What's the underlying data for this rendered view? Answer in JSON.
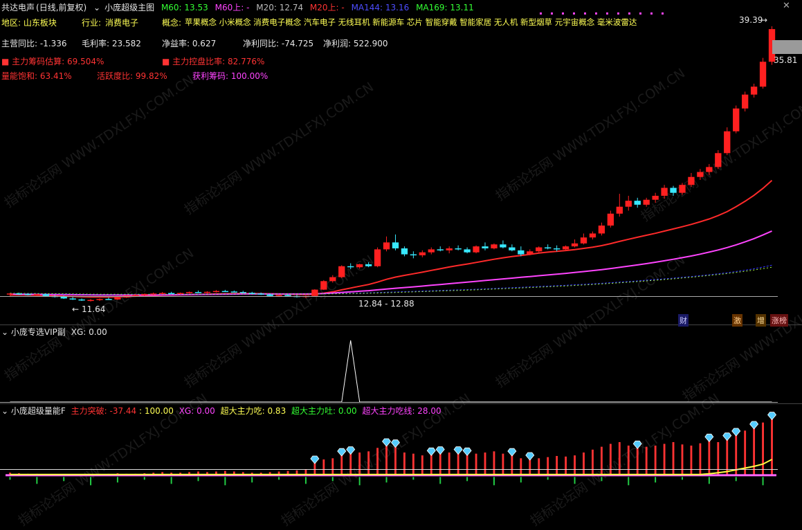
{
  "main_header": {
    "stock": "共达电声",
    "period": "(日线,前复权)",
    "indicator": "小庞超级主图",
    "m60": "M60: 13.53",
    "m60_up": "M60上: -",
    "m20": "M20: 12.74",
    "m20_up": "M20上: -",
    "ma144": "MA144: 13.16",
    "ma169": "MA169: 13.11"
  },
  "info": {
    "region": "地区: 山东板块",
    "industry_label": "行业:",
    "industry": "消费电子",
    "concept_label": "概念:",
    "concepts": "苹果概念 小米概念 消费电子概念 汽车电子 无线耳机 新能源车 芯片 智能穿戴 智能家居 无人机 新型烟草 元宇宙概念 毫米波雷达",
    "rev_growth": "主营同比: -1.336",
    "gross_margin": "毛利率: 23.582",
    "roe": "净益率: 0.627",
    "np_growth": "净利同比: -74.725",
    "net_profit": "净利润: 522.900"
  },
  "chips": {
    "main_chip_est": "主力筹码估算: 69.504%",
    "main_control": "主力控盘比率: 82.776%",
    "vol_sat": "量能饱和: 63.41%",
    "activity": "活跃度比: 99.82%",
    "profit_chip": "获利筹码: 100.00%"
  },
  "price_labels": {
    "high": "39.39",
    "current": "35.81",
    "low": "11.64",
    "range": "12.84 - 12.88"
  },
  "event_tags": [
    "财",
    "激",
    "增",
    "涨榜"
  ],
  "panel2": {
    "title": "小庞专选VIP副",
    "xg": "XG: 0.00"
  },
  "panel3": {
    "title": "小庞超级量能F",
    "main_break": "主力突破: -37.44",
    "level": ": 100.00",
    "xg": "XG: 0.00",
    "super_eat": "超大主力吃: 0.83",
    "super_spit": "超大主力吐: 0.00",
    "super_eat_line": "超大主力吃线: 28.00"
  },
  "watermark": "指标论坛网 WWW.TDXLFXJ.COM.CN",
  "colors": {
    "up": "#ff2020",
    "down": "#38e8ff",
    "m20": "#ff2a2a",
    "m60": "#ff44ff",
    "ma144": "#3333ff",
    "ma169": "#aaff44"
  },
  "chart_data": {
    "type": "candlestick",
    "x_label": "",
    "y_label": "",
    "ylim": [
      11.0,
      40.5
    ],
    "candles": [
      [
        12.35,
        12.5,
        12.2,
        12.45
      ],
      [
        12.45,
        12.55,
        12.3,
        12.4
      ],
      [
        12.4,
        12.48,
        12.25,
        12.3
      ],
      [
        12.3,
        12.42,
        12.2,
        12.38
      ],
      [
        12.38,
        12.45,
        12.15,
        12.2
      ],
      [
        12.2,
        12.3,
        12.05,
        12.15
      ],
      [
        12.15,
        12.25,
        11.9,
        11.95
      ],
      [
        11.95,
        12.1,
        11.8,
        11.85
      ],
      [
        11.85,
        11.95,
        11.7,
        11.75
      ],
      [
        11.75,
        11.9,
        11.64,
        11.8
      ],
      [
        11.8,
        11.95,
        11.7,
        11.9
      ],
      [
        11.9,
        12.05,
        11.8,
        11.85
      ],
      [
        11.85,
        12.1,
        11.8,
        12.05
      ],
      [
        12.05,
        12.3,
        12.0,
        12.25
      ],
      [
        12.25,
        12.4,
        12.15,
        12.3
      ],
      [
        12.3,
        12.45,
        12.2,
        12.4
      ],
      [
        12.4,
        12.55,
        12.3,
        12.45
      ],
      [
        12.45,
        12.6,
        12.35,
        12.5
      ],
      [
        12.5,
        12.62,
        12.4,
        12.42
      ],
      [
        12.42,
        12.55,
        12.35,
        12.5
      ],
      [
        12.5,
        12.65,
        12.45,
        12.6
      ],
      [
        12.6,
        12.75,
        12.5,
        12.55
      ],
      [
        12.55,
        12.68,
        12.45,
        12.62
      ],
      [
        12.62,
        12.8,
        12.55,
        12.7
      ],
      [
        12.7,
        12.82,
        12.6,
        12.65
      ],
      [
        12.65,
        12.75,
        12.55,
        12.6
      ],
      [
        12.6,
        12.72,
        12.48,
        12.52
      ],
      [
        12.52,
        12.62,
        12.4,
        12.45
      ],
      [
        12.45,
        12.55,
        12.3,
        12.35
      ],
      [
        12.35,
        12.45,
        12.15,
        12.2
      ],
      [
        12.2,
        12.35,
        12.1,
        12.3
      ],
      [
        12.3,
        12.4,
        12.15,
        12.2
      ],
      [
        12.2,
        12.3,
        12.05,
        12.1
      ],
      [
        12.1,
        12.25,
        12.0,
        12.2
      ],
      [
        12.2,
        12.88,
        12.15,
        12.84
      ],
      [
        12.84,
        13.8,
        12.8,
        13.7
      ],
      [
        13.7,
        14.3,
        13.55,
        14.1
      ],
      [
        14.1,
        15.3,
        14.0,
        15.2
      ],
      [
        15.2,
        15.5,
        14.9,
        15.1
      ],
      [
        15.1,
        15.45,
        14.95,
        15.4
      ],
      [
        15.4,
        15.6,
        15.1,
        15.2
      ],
      [
        15.2,
        17.1,
        15.1,
        16.9
      ],
      [
        16.9,
        18.2,
        16.7,
        17.6
      ],
      [
        17.6,
        18.4,
        16.8,
        17.0
      ],
      [
        17.0,
        17.2,
        16.2,
        16.4
      ],
      [
        16.4,
        16.7,
        16.0,
        16.3
      ],
      [
        16.3,
        16.8,
        16.1,
        16.6
      ],
      [
        16.6,
        17.1,
        16.4,
        16.9
      ],
      [
        16.9,
        17.2,
        16.7,
        16.8
      ],
      [
        16.8,
        17.2,
        16.5,
        17.0
      ],
      [
        17.0,
        17.3,
        16.8,
        16.9
      ],
      [
        16.9,
        17.1,
        16.5,
        16.6
      ],
      [
        16.6,
        17.3,
        16.5,
        17.2
      ],
      [
        17.2,
        17.6,
        16.8,
        17.0
      ],
      [
        17.0,
        17.5,
        16.9,
        17.4
      ],
      [
        17.4,
        17.8,
        17.0,
        17.1
      ],
      [
        17.1,
        17.4,
        16.7,
        16.8
      ],
      [
        16.8,
        17.2,
        16.2,
        16.4
      ],
      [
        16.4,
        16.9,
        16.3,
        16.7
      ],
      [
        16.7,
        17.2,
        16.6,
        17.1
      ],
      [
        17.1,
        17.4,
        16.9,
        17.0
      ],
      [
        17.0,
        17.3,
        16.7,
        16.9
      ],
      [
        16.9,
        17.3,
        16.8,
        17.2
      ],
      [
        17.2,
        17.9,
        17.1,
        17.5
      ],
      [
        17.5,
        18.5,
        17.4,
        18.1
      ],
      [
        18.1,
        18.7,
        17.9,
        18.5
      ],
      [
        18.5,
        19.6,
        18.3,
        19.3
      ],
      [
        19.3,
        20.8,
        19.1,
        20.5
      ],
      [
        20.5,
        22.5,
        20.2,
        21.2
      ],
      [
        21.2,
        22.3,
        20.8,
        21.8
      ],
      [
        21.8,
        22.1,
        21.1,
        21.4
      ],
      [
        21.4,
        22.1,
        21.2,
        21.9
      ],
      [
        21.9,
        22.6,
        21.6,
        22.3
      ],
      [
        22.3,
        23.4,
        22.0,
        23.1
      ],
      [
        23.1,
        23.3,
        22.3,
        22.6
      ],
      [
        22.6,
        23.6,
        22.4,
        23.4
      ],
      [
        23.4,
        24.6,
        23.2,
        24.2
      ],
      [
        24.2,
        25.0,
        23.9,
        24.7
      ],
      [
        24.7,
        25.5,
        24.4,
        25.2
      ],
      [
        25.2,
        26.9,
        25.0,
        26.6
      ],
      [
        26.6,
        29.2,
        26.4,
        28.8
      ],
      [
        28.8,
        31.4,
        28.6,
        31.1
      ],
      [
        31.1,
        32.8,
        30.8,
        32.5
      ],
      [
        32.5,
        33.6,
        32.2,
        33.3
      ],
      [
        33.3,
        36.2,
        33.1,
        35.81
      ],
      [
        35.81,
        39.39,
        35.5,
        39.1
      ]
    ],
    "series": [
      {
        "name": "M20",
        "values": [
          12.3,
          12.32,
          12.3,
          12.28,
          12.25,
          12.22,
          12.18,
          12.15,
          12.12,
          12.1,
          12.1,
          12.1,
          12.12,
          12.15,
          12.18,
          12.22,
          12.25,
          12.28,
          12.3,
          12.32,
          12.34,
          12.36,
          12.38,
          12.4,
          12.42,
          12.44,
          12.45,
          12.45,
          12.44,
          12.42,
          12.4,
          12.38,
          12.36,
          12.35,
          12.38,
          12.48,
          12.62,
          12.82,
          13.0,
          13.18,
          13.36,
          13.6,
          13.88,
          14.1,
          14.28,
          14.44,
          14.6,
          14.78,
          14.95,
          15.12,
          15.28,
          15.42,
          15.58,
          15.74,
          15.9,
          16.05,
          16.18,
          16.28,
          16.4,
          16.52,
          16.62,
          16.7,
          16.78,
          16.88,
          17.0,
          17.12,
          17.28,
          17.48,
          17.7,
          17.92,
          18.12,
          18.32,
          18.52,
          18.74,
          18.96,
          19.18,
          19.42,
          19.68,
          19.96,
          20.3,
          20.7,
          21.2,
          21.75,
          22.35,
          23.05,
          23.85
        ]
      },
      {
        "name": "M60",
        "values": [
          12.4,
          12.39,
          12.38,
          12.37,
          12.36,
          12.35,
          12.34,
          12.33,
          12.32,
          12.31,
          12.3,
          12.3,
          12.3,
          12.3,
          12.3,
          12.3,
          12.3,
          12.31,
          12.32,
          12.33,
          12.34,
          12.35,
          12.36,
          12.37,
          12.38,
          12.39,
          12.4,
          12.4,
          12.4,
          12.4,
          12.4,
          12.4,
          12.4,
          12.4,
          12.42,
          12.45,
          12.5,
          12.56,
          12.62,
          12.68,
          12.74,
          12.82,
          12.9,
          12.98,
          13.05,
          13.12,
          13.2,
          13.28,
          13.36,
          13.44,
          13.52,
          13.6,
          13.68,
          13.76,
          13.84,
          13.92,
          14.0,
          14.08,
          14.16,
          14.24,
          14.32,
          14.4,
          14.48,
          14.57,
          14.66,
          14.76,
          14.86,
          14.97,
          15.09,
          15.21,
          15.33,
          15.46,
          15.6,
          15.75,
          15.9,
          16.06,
          16.23,
          16.42,
          16.62,
          16.84,
          17.08,
          17.35,
          17.65,
          17.98,
          18.35,
          18.75
        ]
      },
      {
        "name": "MA144",
        "values": [
          12.45,
          12.44,
          12.43,
          12.42,
          12.41,
          12.4,
          12.39,
          12.38,
          12.37,
          12.36,
          12.35,
          12.35,
          12.35,
          12.35,
          12.35,
          12.35,
          12.35,
          12.35,
          12.36,
          12.36,
          12.37,
          12.37,
          12.38,
          12.38,
          12.39,
          12.39,
          12.4,
          12.4,
          12.4,
          12.4,
          12.4,
          12.4,
          12.4,
          12.4,
          12.41,
          12.42,
          12.44,
          12.46,
          12.48,
          12.5,
          12.52,
          12.55,
          12.58,
          12.61,
          12.64,
          12.67,
          12.7,
          12.73,
          12.76,
          12.79,
          12.82,
          12.85,
          12.88,
          12.92,
          12.96,
          13.0,
          13.04,
          13.08,
          13.12,
          13.16,
          13.2,
          13.24,
          13.28,
          13.33,
          13.38,
          13.43,
          13.48,
          13.54,
          13.6,
          13.66,
          13.72,
          13.79,
          13.86,
          13.93,
          14.0,
          14.08,
          14.16,
          14.25,
          14.34,
          14.44,
          14.55,
          14.67,
          14.8,
          14.95,
          15.12,
          15.3
        ]
      },
      {
        "name": "MA169",
        "values": [
          12.48,
          12.47,
          12.46,
          12.45,
          12.44,
          12.43,
          12.42,
          12.41,
          12.4,
          12.39,
          12.38,
          12.38,
          12.38,
          12.38,
          12.38,
          12.38,
          12.38,
          12.38,
          12.38,
          12.38,
          12.39,
          12.39,
          12.39,
          12.4,
          12.4,
          12.4,
          12.4,
          12.4,
          12.4,
          12.4,
          12.4,
          12.4,
          12.4,
          12.4,
          12.4,
          12.41,
          12.42,
          12.43,
          12.45,
          12.46,
          12.48,
          12.5,
          12.53,
          12.55,
          12.58,
          12.61,
          12.64,
          12.67,
          12.7,
          12.73,
          12.76,
          12.79,
          12.82,
          12.86,
          12.9,
          12.93,
          12.97,
          13.01,
          13.05,
          13.09,
          13.13,
          13.17,
          13.21,
          13.26,
          13.31,
          13.36,
          13.41,
          13.47,
          13.53,
          13.59,
          13.65,
          13.72,
          13.79,
          13.86,
          13.93,
          14.01,
          14.09,
          14.18,
          14.27,
          14.36,
          14.46,
          14.57,
          14.69,
          14.82,
          14.96,
          15.1
        ]
      }
    ],
    "sub1": {
      "name": "XG",
      "ylim": [
        0,
        1
      ],
      "values": [
        0,
        0,
        0,
        0,
        0,
        0,
        0,
        0,
        0,
        0,
        0,
        0,
        0,
        0,
        0,
        0,
        0,
        0,
        0,
        0,
        0,
        0,
        0,
        0,
        0,
        0,
        0,
        0,
        0,
        0,
        0,
        0,
        0,
        0,
        0,
        0,
        0,
        0,
        1,
        0,
        0,
        0,
        0,
        0,
        0,
        0,
        0,
        0,
        0,
        0,
        0,
        0,
        0,
        0,
        0,
        0,
        0,
        0,
        0,
        0,
        0,
        0,
        0,
        0,
        0,
        0,
        0,
        0,
        0,
        0,
        0,
        0,
        0,
        0,
        0,
        0,
        0,
        0,
        0,
        0,
        0,
        0,
        0,
        0,
        0,
        0
      ]
    },
    "sub2": {
      "name": "超大主力吃",
      "ylim": [
        -20,
        100
      ],
      "values": [
        5,
        4,
        3,
        3,
        2,
        2,
        1,
        1,
        1,
        2,
        3,
        3,
        4,
        3,
        3,
        4,
        5,
        6,
        5,
        5,
        6,
        7,
        6,
        7,
        8,
        7,
        6,
        5,
        5,
        6,
        7,
        8,
        9,
        10,
        22,
        28,
        30,
        35,
        38,
        40,
        42,
        48,
        52,
        50,
        40,
        38,
        35,
        36,
        38,
        40,
        38,
        36,
        38,
        40,
        42,
        38,
        35,
        30,
        28,
        30,
        32,
        34,
        33,
        35,
        40,
        45,
        50,
        55,
        58,
        52,
        48,
        50,
        52,
        55,
        58,
        54,
        52,
        56,
        60,
        58,
        62,
        70,
        78,
        82,
        92,
        98
      ],
      "line": [
        2,
        2,
        2,
        2,
        2,
        2,
        2,
        2,
        2,
        2,
        2,
        2,
        2,
        2,
        2,
        2,
        2,
        2,
        2,
        2,
        2,
        2,
        2,
        2,
        2,
        2,
        2,
        2,
        2,
        2,
        2,
        2,
        2,
        2,
        2,
        2,
        2,
        2,
        2,
        2,
        2,
        2,
        2,
        2,
        2,
        2,
        2,
        2,
        2,
        2,
        2,
        2,
        2,
        2,
        2,
        2,
        2,
        2,
        2,
        2,
        2,
        2,
        2,
        2,
        2,
        2,
        2,
        2,
        2,
        2,
        2,
        2,
        2,
        2,
        2,
        2,
        2,
        2,
        3,
        5,
        7,
        10,
        13,
        16,
        20,
        28
      ],
      "markers": [
        34,
        37,
        38,
        42,
        43,
        47,
        48,
        50,
        51,
        56,
        58,
        70,
        78,
        80,
        81,
        83,
        85,
        87,
        88,
        90,
        93,
        94,
        96,
        98
      ]
    }
  }
}
